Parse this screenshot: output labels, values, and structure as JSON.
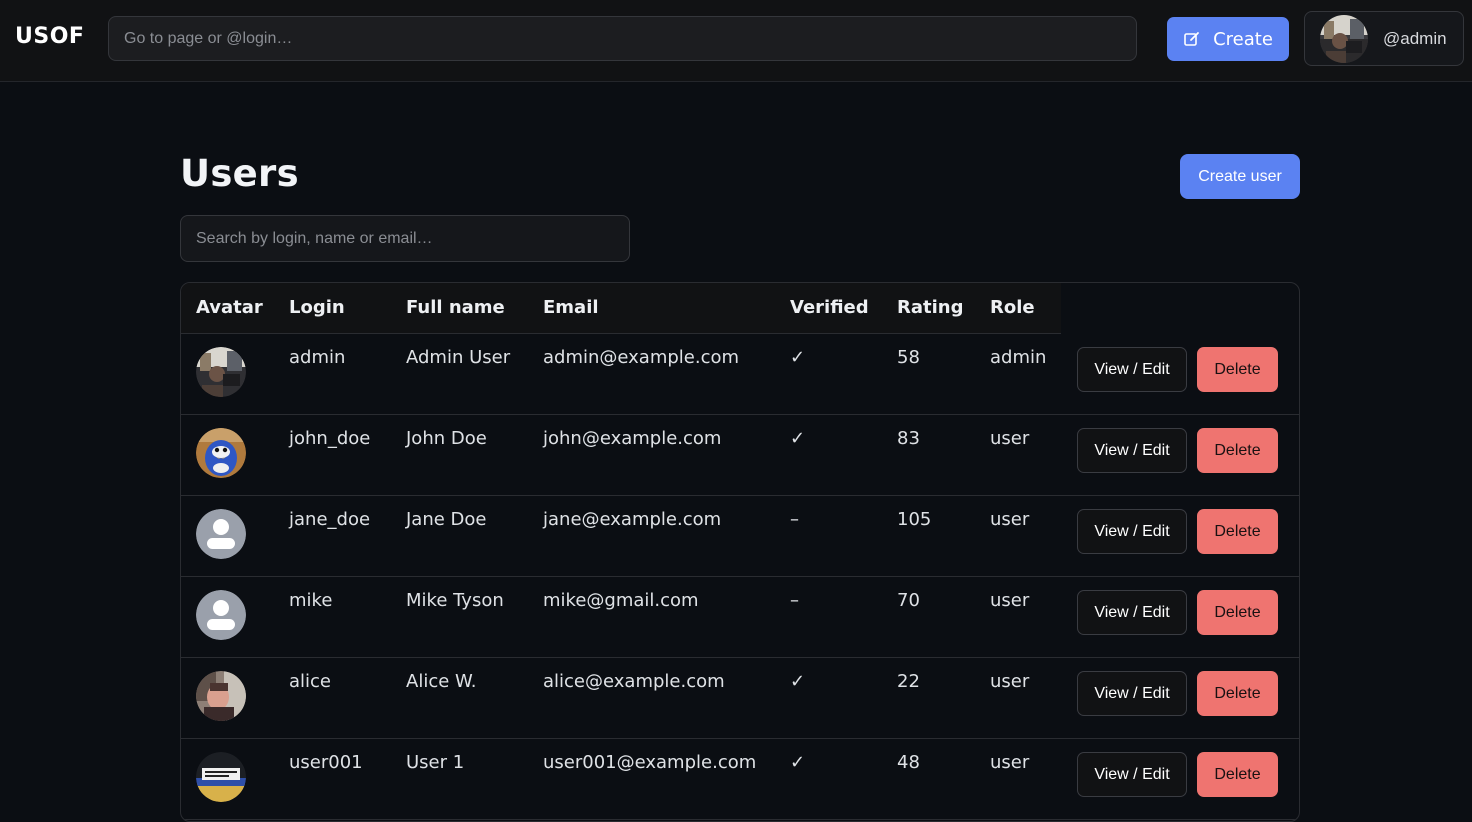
{
  "topbar": {
    "brand": "USOF",
    "goto_placeholder": "Go to page or @login…",
    "create_label": "Create",
    "user_handle": "@admin"
  },
  "page": {
    "title": "Users",
    "create_user_label": "Create user",
    "search_placeholder": "Search by login, name or email…"
  },
  "table": {
    "headers": {
      "avatar": "Avatar",
      "login": "Login",
      "full_name": "Full name",
      "email": "Email",
      "verified": "Verified",
      "rating": "Rating",
      "role": "Role"
    },
    "edit_label": "View / Edit",
    "delete_label": "Delete",
    "rows": [
      {
        "login": "admin",
        "full_name": "Admin User",
        "email": "admin@example.com",
        "verified": "✓",
        "rating": "58",
        "role": "admin",
        "avatar": "photo-room"
      },
      {
        "login": "john_doe",
        "full_name": "John Doe",
        "email": "john@example.com",
        "verified": "✓",
        "rating": "83",
        "role": "user",
        "avatar": "cartoon-bird"
      },
      {
        "login": "jane_doe",
        "full_name": "Jane Doe",
        "email": "jane@example.com",
        "verified": "–",
        "rating": "105",
        "role": "user",
        "avatar": "default-person"
      },
      {
        "login": "mike",
        "full_name": "Mike Tyson",
        "email": "mike@gmail.com",
        "verified": "–",
        "rating": "70",
        "role": "user",
        "avatar": "default-person"
      },
      {
        "login": "alice",
        "full_name": "Alice W.",
        "email": "alice@example.com",
        "verified": "✓",
        "rating": "22",
        "role": "user",
        "avatar": "photo-portrait"
      },
      {
        "login": "user001",
        "full_name": "User 1",
        "email": "user001@example.com",
        "verified": "✓",
        "rating": "48",
        "role": "user",
        "avatar": "photo-badge"
      }
    ]
  },
  "colors": {
    "accent": "#5b82f2",
    "danger": "#ef7470",
    "background": "#0b0e13",
    "topbar": "#111214"
  }
}
